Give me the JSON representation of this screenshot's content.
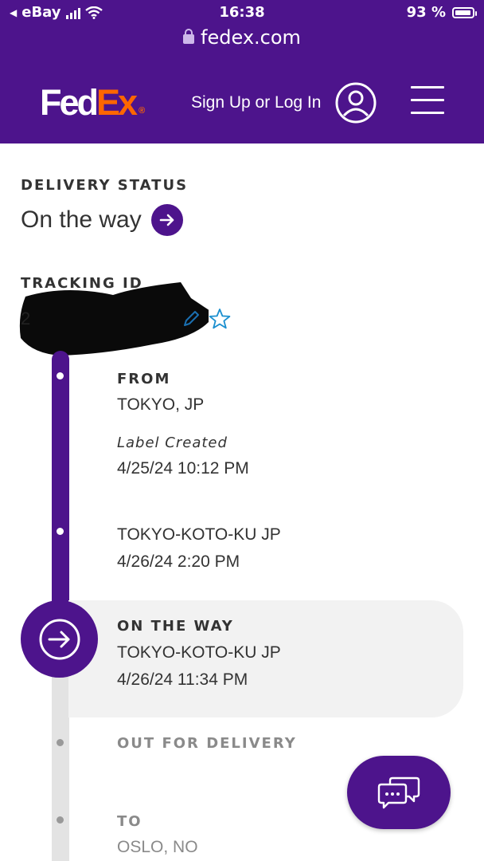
{
  "status_bar": {
    "back_app": "eBay",
    "time": "16:38",
    "battery": "93 %"
  },
  "browser": {
    "url": "fedex.com"
  },
  "header": {
    "logo_fed": "Fed",
    "logo_ex": "Ex",
    "logo_reg": "®",
    "signin_label": "Sign Up or Log In",
    "colors": {
      "brand_purple": "#4d148c",
      "brand_orange": "#ff6600"
    }
  },
  "delivery_status": {
    "label": "DELIVERY STATUS",
    "value": "On the way"
  },
  "tracking": {
    "label": "TRACKING ID",
    "id_visible_prefix": "2"
  },
  "timeline": {
    "from": {
      "label": "FROM",
      "location": "TOKYO, JP",
      "event": "Label Created",
      "datetime": "4/25/24 10:12 PM"
    },
    "scan": {
      "location": "TOKYO-KOTO-KU JP",
      "datetime": "4/26/24 2:20 PM"
    },
    "current": {
      "label": "ON THE WAY",
      "location": "TOKYO-KOTO-KU JP",
      "datetime": "4/26/24 11:34 PM"
    },
    "out_for_delivery": {
      "label": "OUT FOR DELIVERY"
    },
    "to": {
      "label": "TO",
      "location": "OSLO, NO"
    }
  },
  "icons": {
    "user": "user-circle-icon",
    "menu": "hamburger-menu-icon",
    "arrow": "arrow-right-circle-icon",
    "edit": "pencil-icon",
    "star": "star-outline-icon",
    "chat": "chat-bubbles-icon"
  }
}
